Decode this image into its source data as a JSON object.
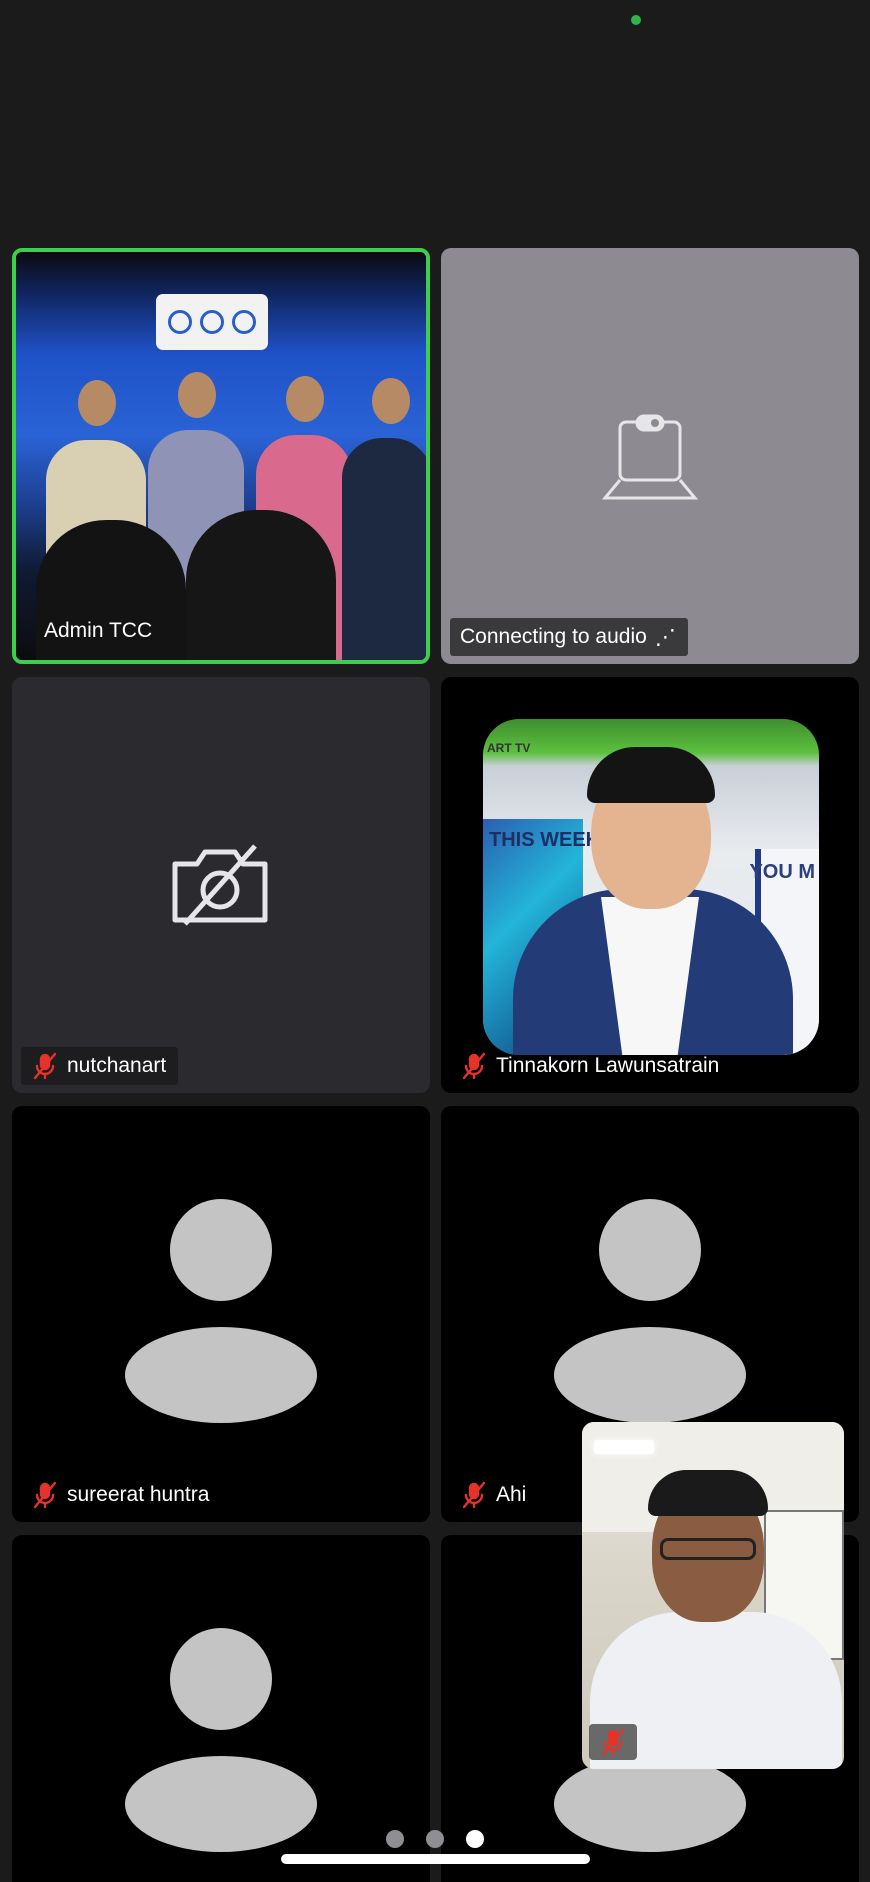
{
  "participants": [
    {
      "name": "Admin TCC",
      "video": "photo-stage",
      "muted": false,
      "active_speaker": true
    },
    {
      "name": "Connecting to audio",
      "suffix": "⋰",
      "video": "none",
      "muted": false,
      "active_speaker": false
    },
    {
      "name": "nutchanart",
      "video": "camera-off",
      "muted": true,
      "active_speaker": false
    },
    {
      "name": "Tinnakorn Lawunsatrain",
      "video": "profile-photo",
      "muted": true,
      "active_speaker": false
    },
    {
      "name": "sureerat huntra",
      "video": "avatar",
      "muted": true,
      "active_speaker": false
    },
    {
      "name": "Ahi",
      "video": "avatar",
      "muted": true,
      "active_speaker": false
    },
    {
      "name": "",
      "video": "avatar",
      "muted": false,
      "active_speaker": false
    },
    {
      "name": "",
      "video": "avatar",
      "muted": false,
      "active_speaker": false
    }
  ],
  "photo_labels": {
    "headshot_left": "THIS WEEK",
    "headshot_right": "YOU M",
    "headshot_top": "ART TV"
  },
  "self_view": {
    "muted": true
  },
  "pager": {
    "count": 3,
    "current": 3
  },
  "colors": {
    "active_border": "#3ccf4e",
    "mute_red": "#e5332a",
    "status_dot": "#2fb34a"
  }
}
